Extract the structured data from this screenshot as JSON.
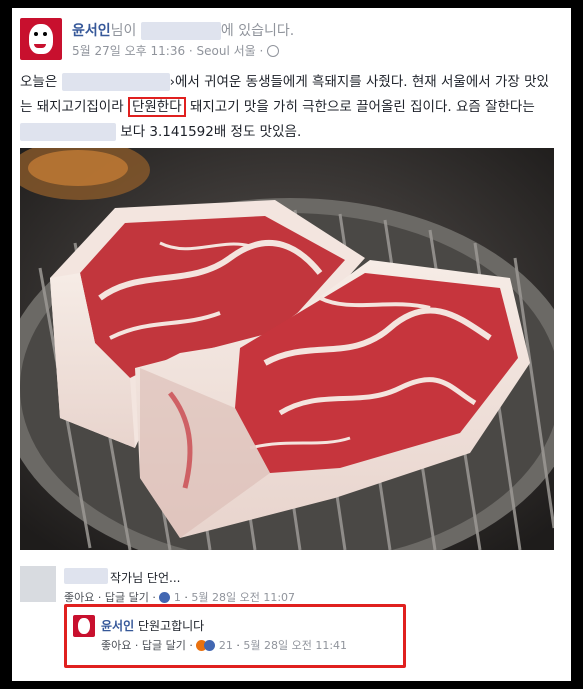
{
  "post": {
    "author": "윤서인",
    "honorific_suffix": "님이",
    "location_suffix": "에 있습니다.",
    "timestamp": "5월 27일 오후 11:36",
    "place": "Seoul 서울",
    "text_part1": "오늘은",
    "text_part2": "›에서 귀여운 동생들에게 흑돼지를 사줬다. 현재 서울에서 가장 맛있는 돼지고기집이라",
    "text_highlight": "단원한다",
    "text_part3": "돼지고기 맛을 가히 극한으로 끌어올린 집이다. 요즘 잘한다는",
    "text_part4": "보다 3.141592배 정도 맛있음."
  },
  "comments": [
    {
      "text": "작가님 단언...",
      "like_label": "좋아요",
      "reply_label": "답글 달기",
      "reaction_count": "1",
      "time": "5월 28일 오전 11:07"
    },
    {
      "author": "윤서인",
      "text": "단원고합니다",
      "like_label": "좋아요",
      "reply_label": "답글 달기",
      "reaction_count": "21",
      "time": "5월 28일 오전 11:41"
    }
  ],
  "colors": {
    "highlight_border": "#e0201f",
    "name_link": "#365899",
    "meta_gray": "#90949c",
    "avatar_red": "#c8102e"
  },
  "icons": [
    "globe-icon",
    "like-reaction-icon",
    "angry-reaction-icon"
  ]
}
